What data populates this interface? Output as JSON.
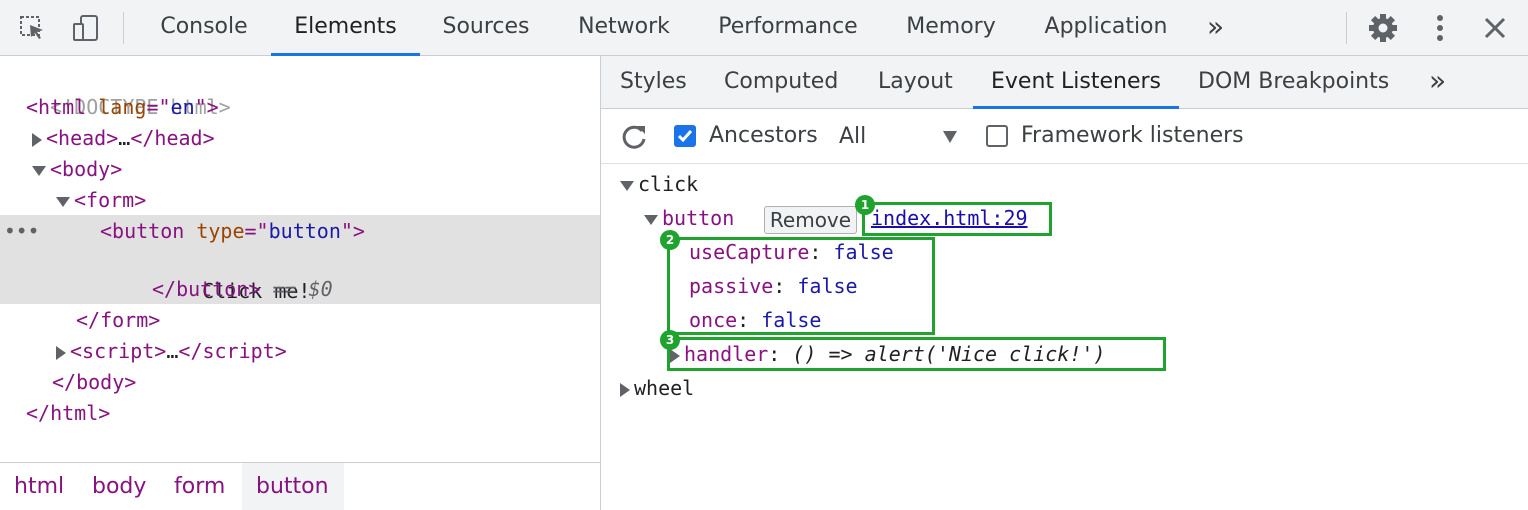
{
  "toolbar": {
    "tabs": [
      {
        "label": "Console"
      },
      {
        "label": "Elements"
      },
      {
        "label": "Sources"
      },
      {
        "label": "Network"
      },
      {
        "label": "Performance"
      },
      {
        "label": "Memory"
      },
      {
        "label": "Application"
      }
    ],
    "more_icon": "double-chevron-right-icon",
    "active_tab": "Elements",
    "accent_color": "#1a73e8"
  },
  "elements_tree": {
    "doctype": "<!DOCTYPE html>",
    "html_open": {
      "tag": "html",
      "attr": "lang",
      "value": "en"
    },
    "head": {
      "open": "head",
      "ellipsis": "…",
      "close": "/head"
    },
    "body": "body",
    "form": "form",
    "button": {
      "tag": "button",
      "attr": "type",
      "value": "button",
      "text": "Click me!",
      "close": "/button",
      "ref": "== $0"
    },
    "form_close": "/form",
    "script": {
      "open": "script",
      "ellipsis": "…",
      "close": "/script"
    },
    "body_close": "/body",
    "html_close": "/html",
    "dots": "•••"
  },
  "breadcrumbs": [
    "html",
    "body",
    "form",
    "button"
  ],
  "side_tabs": [
    {
      "label": "Styles"
    },
    {
      "label": "Computed"
    },
    {
      "label": "Layout"
    },
    {
      "label": "Event Listeners"
    },
    {
      "label": "DOM Breakpoints"
    }
  ],
  "filter": {
    "ancestors_label": "Ancestors",
    "ancestors_checked": true,
    "select_value": "All",
    "framework_label": "Framework listeners",
    "framework_checked": false
  },
  "listeners": {
    "click": "click",
    "node": "button",
    "remove_label": "Remove",
    "location": "index.html:29",
    "use_capture": {
      "key": "useCapture",
      "value": "false"
    },
    "passive": {
      "key": "passive",
      "value": "false"
    },
    "once": {
      "key": "once",
      "value": "false"
    },
    "handler": {
      "key": "handler",
      "value": "() => alert('Nice click!')"
    },
    "wheel": "wheel"
  },
  "badges": [
    "1",
    "2",
    "3"
  ],
  "highlight_color": "#1fa22e"
}
